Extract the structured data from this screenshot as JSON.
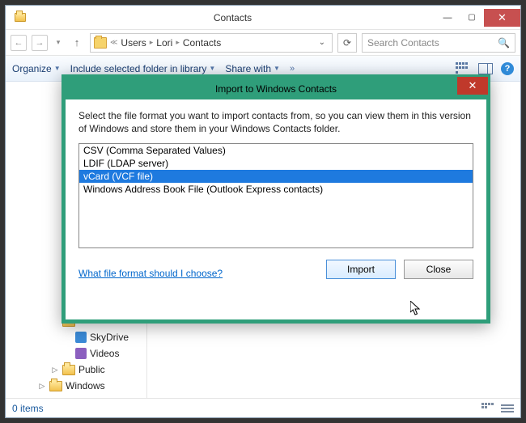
{
  "window": {
    "title": "Contacts",
    "breadcrumbs": [
      "Users",
      "Lori",
      "Contacts"
    ],
    "search_placeholder": "Search Contacts"
  },
  "cmdbar": {
    "organize": "Organize",
    "include": "Include selected folder in library",
    "share": "Share with"
  },
  "tree": [
    {
      "depth": 0,
      "twisty": "",
      "icon": "folder",
      "label": ""
    },
    {
      "depth": 0,
      "twisty": "",
      "icon": "folder",
      "label": ""
    },
    {
      "depth": 0,
      "twisty": "",
      "icon": "folder",
      "label": ""
    },
    {
      "depth": 0,
      "twisty": "",
      "icon": "folder",
      "label": ""
    },
    {
      "depth": 0,
      "twisty": "",
      "icon": "folder",
      "label": ""
    },
    {
      "depth": 0,
      "twisty": "",
      "icon": "folder",
      "label": ""
    },
    {
      "depth": 0,
      "twisty": "",
      "icon": "folder",
      "label": ""
    },
    {
      "depth": 0,
      "twisty": "",
      "icon": "folder",
      "label": ""
    },
    {
      "depth": 0,
      "twisty": "",
      "icon": "folder",
      "label": ""
    },
    {
      "depth": 0,
      "twisty": "",
      "icon": "folder",
      "label": ""
    },
    {
      "depth": 0,
      "twisty": "",
      "icon": "folder",
      "label": ""
    },
    {
      "depth": 0,
      "twisty": "",
      "icon": "folder",
      "label": ""
    },
    {
      "depth": 0,
      "twisty": "",
      "icon": "folder",
      "label": ""
    },
    {
      "depth": 0,
      "twisty": "",
      "icon": "folder",
      "label": ""
    },
    {
      "depth": 0,
      "twisty": "",
      "icon": "folder",
      "label": ""
    },
    {
      "depth": 1,
      "twisty": "",
      "icon": "sp-blue",
      "label": "SkyDrive"
    },
    {
      "depth": 1,
      "twisty": "",
      "icon": "sp-purple",
      "label": "Videos"
    },
    {
      "depth": 0,
      "twisty": "▷",
      "icon": "folder",
      "label": "Public"
    },
    {
      "depth": -1,
      "twisty": "▷",
      "icon": "folder",
      "label": "Windows"
    }
  ],
  "status": {
    "items": "0 items"
  },
  "dialog": {
    "title": "Import to Windows Contacts",
    "instruction": "Select the file format you want to import contacts from, so you can view them in this version of Windows and store them in your Windows Contacts folder.",
    "options": [
      "CSV (Comma Separated Values)",
      "LDIF (LDAP server)",
      "vCard (VCF file)",
      "Windows Address Book File (Outlook Express contacts)"
    ],
    "selected_index": 2,
    "help_link": "What file format should I choose?",
    "import_btn": "Import",
    "close_btn": "Close"
  }
}
